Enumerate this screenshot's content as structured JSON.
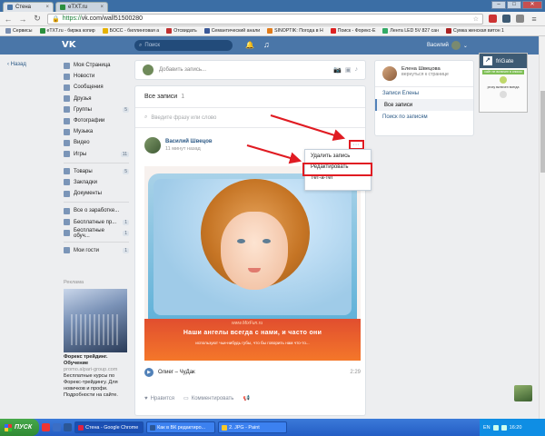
{
  "browser": {
    "tabs": [
      {
        "label": "Стена"
      },
      {
        "label": "eTXT.ru"
      }
    ],
    "url_https": "https://",
    "url_rest": "vk.com/wall51500280",
    "bookmarks": [
      {
        "label": "Сервисы",
        "color": "#7b8fb0"
      },
      {
        "label": "eTXT.ru - биржа копир",
        "color": "#2b8f3e"
      },
      {
        "label": "БОСС - биллинговая а",
        "color": "#e6b200"
      },
      {
        "label": "Отсвидать",
        "color": "#c03030"
      },
      {
        "label": "Семантический анали",
        "color": "#3b5998"
      },
      {
        "label": "SINOPTIK: Погода в Н",
        "color": "#e07b1a"
      },
      {
        "label": "Поиск - Форекс-Е",
        "color": "#d22"
      },
      {
        "label": "Лента LED 5V 827 сан",
        "color": "#3a6"
      },
      {
        "label": "Сумка женская витон 1",
        "color": "#a22"
      }
    ]
  },
  "vk": {
    "search_placeholder": "Поиск",
    "user_name": "Василий",
    "back_label": "Назад",
    "menu": [
      {
        "label": "Моя Страница",
        "count": ""
      },
      {
        "label": "Новости",
        "count": ""
      },
      {
        "label": "Сообщения",
        "count": ""
      },
      {
        "label": "Друзья",
        "count": ""
      },
      {
        "label": "Группы",
        "count": "5"
      },
      {
        "label": "Фотографии",
        "count": ""
      },
      {
        "label": "Музыка",
        "count": ""
      },
      {
        "label": "Видео",
        "count": ""
      },
      {
        "label": "Игры",
        "count": "11"
      }
    ],
    "menu2": [
      {
        "label": "Товары",
        "count": "5"
      },
      {
        "label": "Закладки",
        "count": ""
      },
      {
        "label": "Документы",
        "count": ""
      }
    ],
    "menu3": [
      {
        "label": "Все о заработке...",
        "count": ""
      },
      {
        "label": "Бесплатные пр...",
        "count": "1"
      },
      {
        "label": "Бесплатные обуч...",
        "count": "1"
      }
    ],
    "menu4": [
      {
        "label": "Мои гости",
        "count": "1"
      }
    ],
    "ad": {
      "label": "Реклама",
      "title": "Форекс трейдинг. Обучение",
      "domain": "promo.alpari-group.com",
      "text": "Бесплатные курсы по Форекс-трейдингу. Для новичков и профи. Подробности на сайте."
    }
  },
  "wall": {
    "new_post_placeholder": "Добавить запись...",
    "all_posts_label": "Все записи",
    "all_posts_count": "1",
    "search_placeholder": "Введите фразу или слово",
    "post": {
      "author": "Василий Швецов",
      "date": "11 минут назад",
      "watermark": "www.MixFun.ru",
      "caption_big": "Наши ангелы всегда с нами,  и часто они",
      "caption_small": "используют чьи-нибудь губы, что бы говорить нам что-то...",
      "audio_title": "Олиег – ЧуДак",
      "audio_duration": "2:29",
      "like_label": "Нравится",
      "comment_label": "Комментировать"
    },
    "dropdown": [
      {
        "label": "Удалить запись"
      },
      {
        "label": "Редактировать"
      },
      {
        "label": "Тет-а-тет"
      }
    ]
  },
  "right": {
    "profile_name": "Елена Швецова",
    "profile_status": "вернуться к странице",
    "links": [
      {
        "label": "Записи Елены"
      },
      {
        "label": "Все записи"
      },
      {
        "label": "Поиск по записям"
      }
    ]
  },
  "frigate": {
    "title": "friGate",
    "status": "сайт не включен в список",
    "proxy": "proxy включен всегда"
  },
  "taskbar": {
    "start": "ПУСК",
    "tasks": [
      {
        "label": "Стена - Google Chrome",
        "color": "#d24"
      },
      {
        "label": "Как в ВК редактиро...",
        "color": "#2b5797"
      },
      {
        "label": "2. JPG - Paint",
        "color": "#f7c82b"
      }
    ],
    "lang": "EN",
    "clock": "16:20"
  },
  "colors": {
    "vk_blue": "#4a76a8",
    "annotation_red": "#e01b22"
  }
}
